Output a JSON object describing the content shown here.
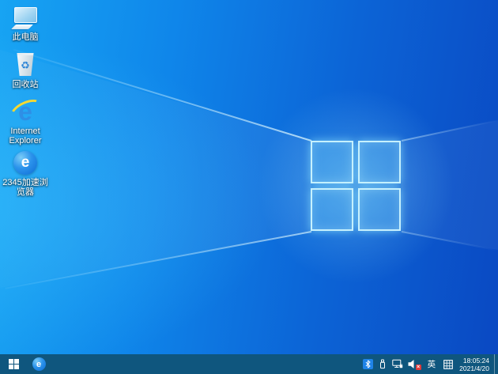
{
  "desktop": {
    "icons": [
      {
        "id": "this-pc",
        "label": "此电脑"
      },
      {
        "id": "recycle-bin",
        "label": "回收站"
      },
      {
        "id": "internet-explorer",
        "label": "Internet Explorer"
      },
      {
        "id": "2345-browser",
        "label": "2345加速浏览器"
      }
    ]
  },
  "glyphs": {
    "ie_e": "e",
    "browser_2345_e": "e",
    "recycle_symbol": "♻",
    "mute_x": "×"
  },
  "taskbar": {
    "tray": {
      "language_indicator": "英",
      "icons": [
        "bluetooth-icon",
        "usb-device-icon",
        "network-icon",
        "volume-muted-icon",
        "ime-icon"
      ],
      "clock": {
        "time": "18:05:24",
        "date": "2021/4/20"
      }
    }
  },
  "colors": {
    "taskbar_bg": "#0f567e",
    "wallpaper_left": "#14aaf5",
    "wallpaper_right": "#0a48c8",
    "bluetooth_badge": "#1f83e8",
    "mute_badge": "#e23c3c",
    "ie_blue": "#2e8fe6",
    "ie_orbit_yellow": "#f6d931"
  }
}
